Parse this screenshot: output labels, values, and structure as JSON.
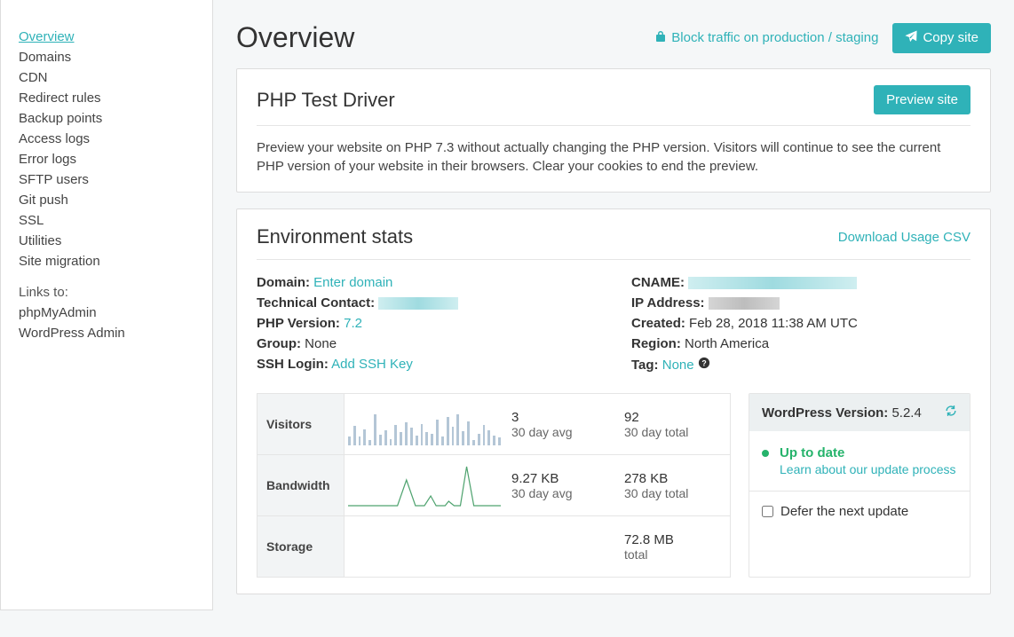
{
  "sidebar": {
    "items": [
      {
        "label": "Overview",
        "active": true
      },
      {
        "label": "Domains"
      },
      {
        "label": "CDN"
      },
      {
        "label": "Redirect rules"
      },
      {
        "label": "Backup points"
      },
      {
        "label": "Access logs"
      },
      {
        "label": "Error logs"
      },
      {
        "label": "SFTP users"
      },
      {
        "label": "Git push"
      },
      {
        "label": "SSL"
      },
      {
        "label": "Utilities"
      },
      {
        "label": "Site migration"
      }
    ],
    "links_to_label": "Links to:",
    "external": [
      {
        "label": "phpMyAdmin"
      },
      {
        "label": "WordPress Admin"
      }
    ]
  },
  "header": {
    "title": "Overview",
    "block_traffic_label": "Block traffic on production / staging",
    "copy_site_label": "Copy site"
  },
  "php_test": {
    "title": "PHP Test Driver",
    "preview_btn": "Preview site",
    "description": "Preview your website on PHP 7.3 without actually changing the PHP version. Visitors will continue to see the current PHP version of your website in their browsers. Clear your cookies to end the preview."
  },
  "env": {
    "title": "Environment stats",
    "download_csv": "Download Usage CSV",
    "left": {
      "domain_label": "Domain:",
      "domain_value": "Enter domain",
      "tech_contact_label": "Technical Contact:",
      "php_version_label": "PHP Version:",
      "php_version_value": "7.2",
      "group_label": "Group:",
      "group_value": "None",
      "ssh_login_label": "SSH Login:",
      "ssh_login_value": "Add SSH Key"
    },
    "right": {
      "cname_label": "CNAME:",
      "ip_label": "IP Address:",
      "created_label": "Created:",
      "created_value": "Feb 28, 2018 11:38 AM UTC",
      "region_label": "Region:",
      "region_value": "North America",
      "tag_label": "Tag:",
      "tag_value": "None"
    }
  },
  "metrics": {
    "visitors": {
      "name": "Visitors",
      "avg": "3",
      "avg_label": "30 day avg",
      "total": "92",
      "total_label": "30 day total"
    },
    "bandwidth": {
      "name": "Bandwidth",
      "avg": "9.27 KB",
      "avg_label": "30 day avg",
      "total": "278 KB",
      "total_label": "30 day total"
    },
    "storage": {
      "name": "Storage",
      "total": "72.8 MB",
      "total_label": "total"
    }
  },
  "wp": {
    "version_label": "WordPress Version:",
    "version_value": "5.2.4",
    "status": "Up to date",
    "learn": "Learn about our update process",
    "defer": "Defer the next update"
  }
}
